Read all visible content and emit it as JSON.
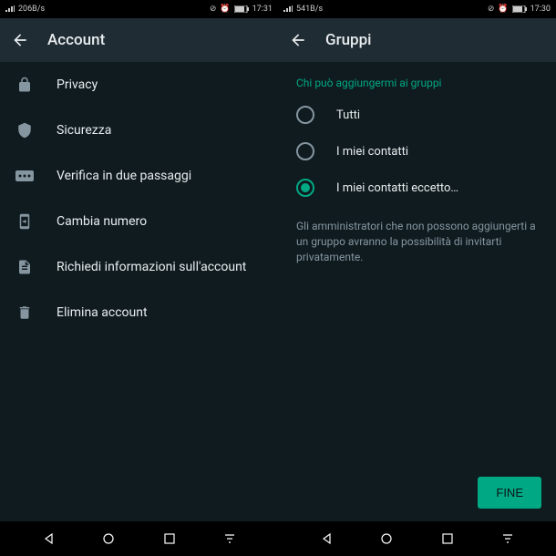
{
  "left": {
    "status": {
      "speed": "206B/s",
      "time": "17:31"
    },
    "title": "Account",
    "items": [
      {
        "icon": "lock",
        "label": "Privacy"
      },
      {
        "icon": "shield",
        "label": "Sicurezza"
      },
      {
        "icon": "dots",
        "label": "Verifica in due passaggi"
      },
      {
        "icon": "phone-swap",
        "label": "Cambia numero"
      },
      {
        "icon": "document",
        "label": "Richiedi informazioni sull'account"
      },
      {
        "icon": "trash",
        "label": "Elimina account"
      }
    ]
  },
  "right": {
    "status": {
      "speed": "541B/s",
      "time": "17:30"
    },
    "title": "Gruppi",
    "section_header": "Chi può aggiungermi ai gruppi",
    "options": [
      {
        "label": "Tutti",
        "selected": false
      },
      {
        "label": "I miei contatti",
        "selected": false
      },
      {
        "label": "I miei contatti eccetto…",
        "selected": true
      }
    ],
    "helper": "Gli amministratori che non possono aggiungerti a un gruppo avranno la possibilità di invitarti privatamente.",
    "done": "FINE"
  },
  "colors": {
    "accent": "#00a884",
    "bg": "#0f1b1f",
    "bar": "#1f2c34"
  }
}
